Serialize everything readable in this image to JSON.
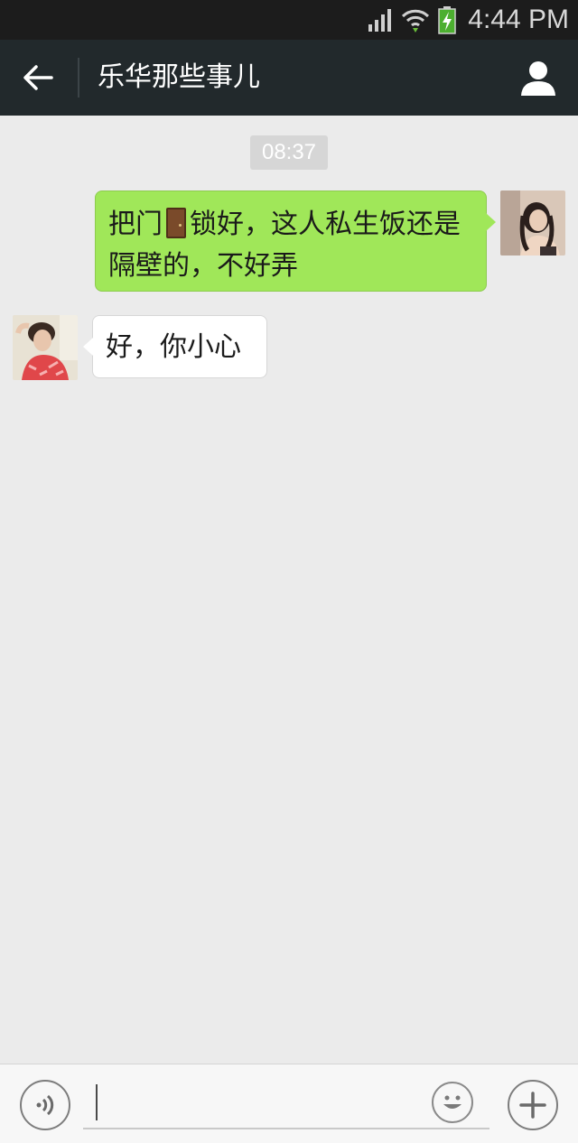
{
  "status_bar": {
    "time": "4:44 PM",
    "icons": [
      "signal-icon",
      "wifi-icon",
      "battery-charging-icon"
    ]
  },
  "header": {
    "title": "乐华那些事儿",
    "back_icon": "arrow-left-icon",
    "profile_icon": "person-icon",
    "background": "#22292c"
  },
  "messages": {
    "timestamp": "08:37",
    "outgoing": {
      "text_before": "把门",
      "emoji": "door-emoji",
      "text_after": "锁好，这人私生饭还是隔壁的，不好弄",
      "bubble_color": "#a0e759"
    },
    "incoming": {
      "text": "好，你小心",
      "bubble_color": "#ffffff"
    }
  },
  "input_bar": {
    "value": "",
    "voice_icon": "voice-icon",
    "emoji_icon": "smiley-icon",
    "plus_icon": "plus-icon"
  }
}
